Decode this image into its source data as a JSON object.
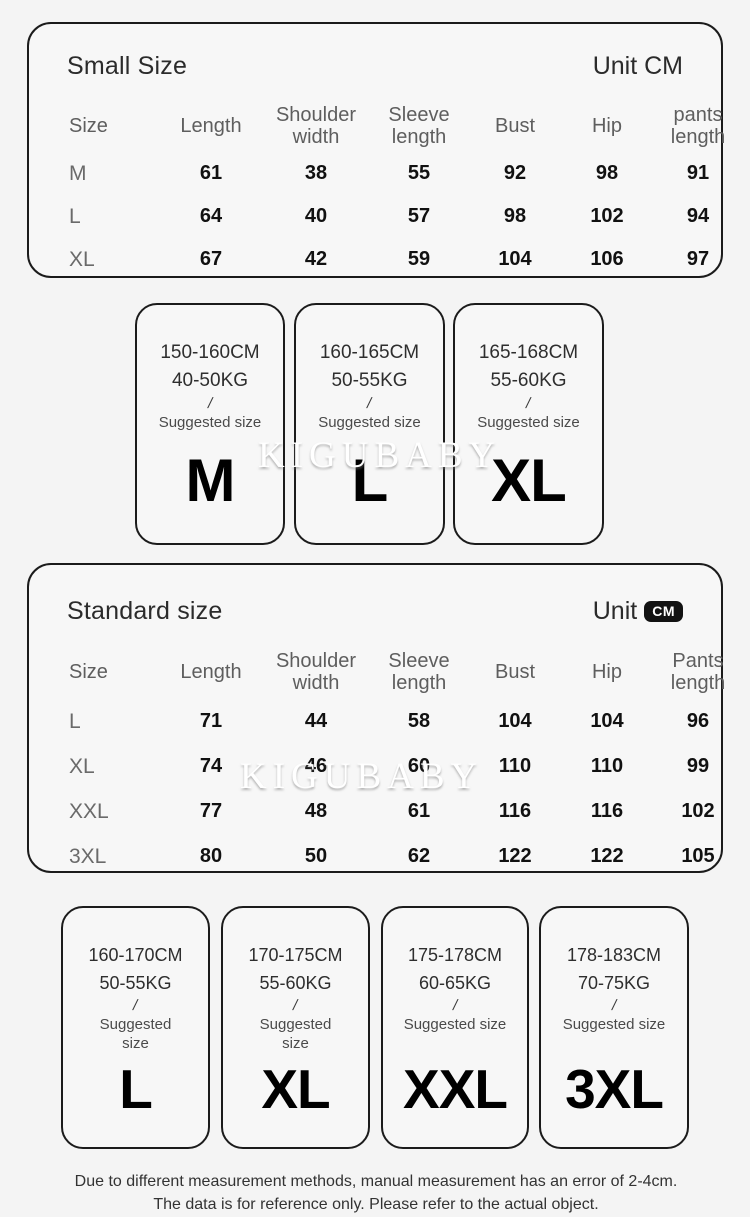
{
  "tables": [
    {
      "title": "Small Size",
      "unit_label": "Unit CM",
      "unit_badge": null,
      "headers": [
        "Size",
        "Length",
        "Shoulder width",
        "Sleeve length",
        "Bust",
        "Hip",
        "pants length"
      ],
      "rows": [
        {
          "size": "M",
          "values": [
            "61",
            "38",
            "55",
            "92",
            "98",
            "91"
          ]
        },
        {
          "size": "L",
          "values": [
            "64",
            "40",
            "57",
            "98",
            "102",
            "94"
          ]
        },
        {
          "size": "XL",
          "values": [
            "67",
            "42",
            "59",
            "104",
            "106",
            "97"
          ]
        }
      ]
    },
    {
      "title": "Standard size",
      "unit_label": "Unit",
      "unit_badge": "CM",
      "headers": [
        "Size",
        "Length",
        "Shoulder width",
        "Sleeve length",
        "Bust",
        "Hip",
        "Pants length"
      ],
      "rows": [
        {
          "size": "L",
          "values": [
            "71",
            "44",
            "58",
            "104",
            "104",
            "96"
          ]
        },
        {
          "size": "XL",
          "values": [
            "74",
            "46",
            "60",
            "110",
            "110",
            "99"
          ]
        },
        {
          "size": "XXL",
          "values": [
            "77",
            "48",
            "61",
            "116",
            "116",
            "102"
          ]
        },
        {
          "size": "3XL",
          "values": [
            "80",
            "50",
            "62",
            "122",
            "122",
            "105"
          ]
        }
      ]
    }
  ],
  "suggestion_rows": [
    {
      "cards": [
        {
          "height": "150-160CM",
          "weight": "40-50KG",
          "slash": "/",
          "label": "Suggested size",
          "size": "M"
        },
        {
          "height": "160-165CM",
          "weight": "50-55KG",
          "slash": "/",
          "label": "Suggested size",
          "size": "L"
        },
        {
          "height": "165-168CM",
          "weight": "55-60KG",
          "slash": "/",
          "label": "Suggested size",
          "size": "XL"
        }
      ]
    },
    {
      "cards": [
        {
          "height": "160-170CM",
          "weight": "50-55KG",
          "slash": "/",
          "label": "Suggested size",
          "size": "L"
        },
        {
          "height": "170-175CM",
          "weight": "55-60KG",
          "slash": "/",
          "label": "Suggested size",
          "size": "XL"
        },
        {
          "height": "175-178CM",
          "weight": "60-65KG",
          "slash": "/",
          "label": "Suggested size",
          "size": "XXL"
        },
        {
          "height": "178-183CM",
          "weight": "70-75KG",
          "slash": "/",
          "label": "Suggested size",
          "size": "3XL"
        }
      ]
    }
  ],
  "footer": {
    "note": "Due to different measurement methods, manual measurement has an error of 2-4cm. The data is for reference only. Please refer to the actual object."
  },
  "watermark": {
    "text": "KIGUBABY"
  },
  "colors": {
    "page_background": "#f4f4f4",
    "card_background": "#f7f7f7",
    "border": "#1b1b1b",
    "value_text": "#111111",
    "header_text": "#5e5e5e",
    "badge_background": "#121212",
    "badge_text": "#ffffff"
  }
}
